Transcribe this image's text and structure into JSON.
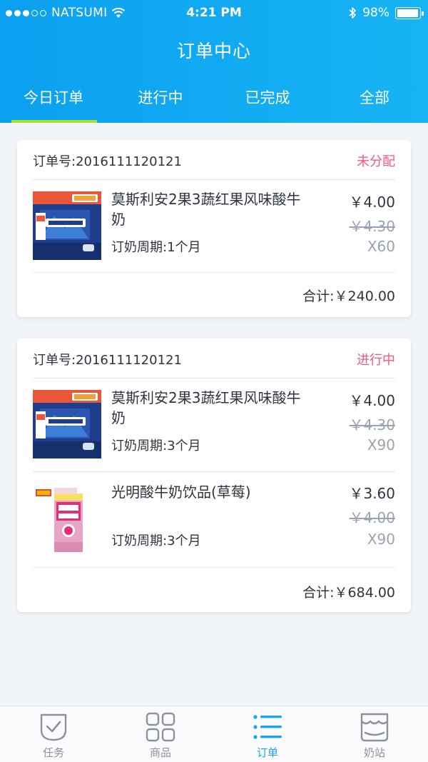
{
  "status_bar": {
    "carrier": "NATSUMI",
    "time": "4:21 PM",
    "battery": "98%",
    "battery_level": 0.98
  },
  "header": {
    "title": "订单中心",
    "tabs": [
      {
        "label": "今日订单",
        "active": true
      },
      {
        "label": "进行中",
        "active": false
      },
      {
        "label": "已完成",
        "active": false
      },
      {
        "label": "全部",
        "active": false
      }
    ]
  },
  "orders": [
    {
      "order_no": "订单号:2016111120121",
      "status": "未分配",
      "items": [
        {
          "name": "莫斯利安2果3蔬红果风味酸牛奶",
          "period": "订奶周期:1个月",
          "price": "￥4.00",
          "original_price": "￥4.30",
          "quantity": "X60",
          "image": "mosilian-yogurt-box"
        }
      ],
      "total": "合计:￥240.00"
    },
    {
      "order_no": "订单号:2016111120121",
      "status": "进行中",
      "items": [
        {
          "name": "莫斯利安2果3蔬红果风味酸牛奶",
          "period": "订奶周期:3个月",
          "price": "￥4.00",
          "original_price": "￥4.30",
          "quantity": "X90",
          "image": "mosilian-yogurt-box"
        },
        {
          "name": "光明酸牛奶饮品(草莓)",
          "period": "订奶周期:3个月",
          "price": "￥3.60",
          "original_price": "￥4.00",
          "quantity": "X90",
          "image": "bright-strawberry-yogurt-carton"
        }
      ],
      "total": "合计:￥684.00"
    }
  ],
  "bottom_nav": [
    {
      "label": "任务",
      "icon": "task-check-icon",
      "active": false
    },
    {
      "label": "商品",
      "icon": "grid-icon",
      "active": false
    },
    {
      "label": "订单",
      "icon": "list-icon",
      "active": true
    },
    {
      "label": "奶站",
      "icon": "milk-station-icon",
      "active": false
    }
  ],
  "colors": {
    "header_gradient_start": "#0ba0f0",
    "header_gradient_end": "#17b4f4",
    "tab_indicator": "#a6e22e",
    "status_text": "#f05a7a",
    "active_nav": "#1aa3ef",
    "muted_text": "#9aa3b0"
  }
}
